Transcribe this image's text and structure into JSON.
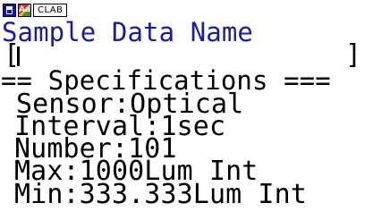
{
  "status_bar": {
    "battery_icon": "battery-icon",
    "mode_icon": "mode-icon",
    "mode_label": "Aa",
    "app_label": "CLAB"
  },
  "screen": {
    "title": "Sample Data Name",
    "name_input": {
      "value": "",
      "left_bracket": "[",
      "right_bracket": "]"
    },
    "spec_header": "== Specifications ===",
    "specs": [
      "Sensor:Optical",
      "Interval:1sec",
      "Number:101",
      "Max:1000Lum Int",
      "Min:333.333Lum Int"
    ]
  },
  "colors": {
    "title": "#1a1aa8",
    "text": "#000000",
    "background": "#ffffff"
  }
}
